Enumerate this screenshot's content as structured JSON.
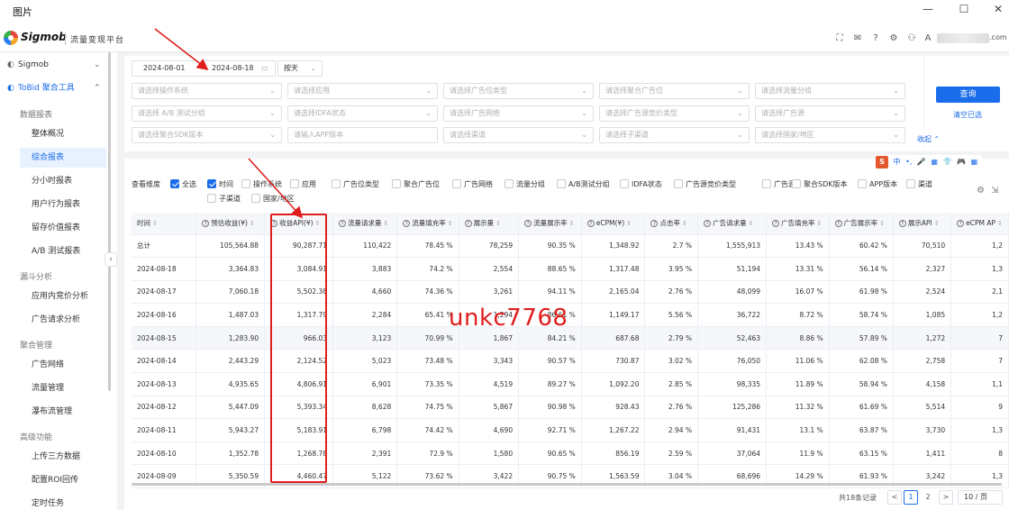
{
  "window": {
    "title": "图片"
  },
  "brand": {
    "name": "Sigmob",
    "subtitle": "流量变现平台",
    "email_suffix": ".com"
  },
  "sidebar": {
    "items": [
      {
        "label": "Sigmob"
      },
      {
        "label": "ToBid 聚合工具"
      }
    ],
    "groups": {
      "data_report": "数据报表",
      "funnel": "漏斗分析",
      "aggregation": "聚合管理",
      "advanced": "高级功能"
    },
    "data_report_items": [
      "整体概况",
      "综合报表",
      "分小时报表",
      "用户行为报表",
      "留存价值报表",
      "A/B 测试报表"
    ],
    "funnel_items": [
      "应用内竞价分析",
      "广告请求分析"
    ],
    "aggregation_items": [
      "广告网络",
      "流量管理",
      "瀑布流管理"
    ],
    "advanced_items": [
      "上传三方数据",
      "配置ROI回传",
      "定时任务"
    ]
  },
  "filters": {
    "date_start": "2024-08-01",
    "date_arrow": "→",
    "date_end": "2024-08-18",
    "granularity": "按天",
    "row1": [
      "请选择操作系统",
      "请选择应用",
      "请选择广告位类型",
      "请选择聚合广告位",
      "请选择流量分组"
    ],
    "row2": [
      "请选择 A/B 测试分组",
      "请选择IDFA状态",
      "请选择广告网络",
      "请选择广告源竞价类型",
      "请选择广告源"
    ],
    "row3": [
      "请选择聚合SDK版本",
      "请输入APP版本",
      "请选择渠道",
      "请选择子渠道",
      "请选择国家/地区"
    ],
    "query_label": "查询",
    "clear_label": "清空已选",
    "collapse_label": "收起 ⌃"
  },
  "dimensions": {
    "label": "查看维度",
    "select_all": "全选",
    "items": [
      "时间",
      "操作系统",
      "应用",
      "广告位类型",
      "聚合广告位",
      "广告网络",
      "流量分组",
      "A/B测试分组",
      "IDFA状态",
      "广告源竞价类型",
      "广告源",
      "聚合SDK版本",
      "APP版本",
      "渠道",
      "子渠道",
      "国家/地区"
    ],
    "checked": [
      "全选",
      "时间"
    ]
  },
  "ime": {
    "s": "S",
    "items": [
      "中",
      "•,",
      "🎤",
      "▦",
      "👕",
      "🎮",
      "▦"
    ]
  },
  "table": {
    "columns": [
      {
        "label": "时间",
        "q": false
      },
      {
        "label": "预估收益(¥)",
        "q": true
      },
      {
        "label": "收益API(¥)",
        "q": true
      },
      {
        "label": "流量请求量",
        "q": true
      },
      {
        "label": "流量填充率",
        "q": true
      },
      {
        "label": "展示量",
        "q": true
      },
      {
        "label": "流量展示率",
        "q": true
      },
      {
        "label": "eCPM(¥)",
        "q": true
      },
      {
        "label": "点击率",
        "q": true
      },
      {
        "label": "广告请求量",
        "q": true
      },
      {
        "label": "广告填充率",
        "q": true
      },
      {
        "label": "广告展示率",
        "q": true
      },
      {
        "label": "展示API",
        "q": true
      },
      {
        "label": "eCPM AP",
        "q": true
      }
    ],
    "rows": [
      [
        "总计",
        "105,564.88",
        "90,287.71",
        "110,422",
        "78.45 %",
        "78,259",
        "90.35 %",
        "1,348.92",
        "2.7 %",
        "1,555,913",
        "13.43 %",
        "60.42 %",
        "70,510",
        "1,2"
      ],
      [
        "2024-08-18",
        "3,364.83",
        "3,084.91",
        "3,883",
        "74.2 %",
        "2,554",
        "88.65 %",
        "1,317.48",
        "3.95 %",
        "51,194",
        "13.31 %",
        "56.14 %",
        "2,327",
        "1,3"
      ],
      [
        "2024-08-17",
        "7,060.18",
        "5,502.38",
        "4,660",
        "74.36 %",
        "3,261",
        "94.11 %",
        "2,165.04",
        "2.76 %",
        "48,099",
        "16.07 %",
        "61.98 %",
        "2,524",
        "2,1"
      ],
      [
        "2024-08-16",
        "1,487.03",
        "1,317.79",
        "2,284",
        "65.41 %",
        "1,294",
        "86.61 %",
        "1,149.17",
        "5.56 %",
        "36,722",
        "8.72 %",
        "58.74 %",
        "1,085",
        "1,2"
      ],
      [
        "2024-08-15",
        "1,283.90",
        "966.03",
        "3,123",
        "70.99 %",
        "1,867",
        "84.21 %",
        "687.68",
        "2.79 %",
        "52,463",
        "8.86 %",
        "57.89 %",
        "1,272",
        "7"
      ],
      [
        "2024-08-14",
        "2,443.29",
        "2,124.52",
        "5,023",
        "73.48 %",
        "3,343",
        "90.57 %",
        "730.87",
        "3.02 %",
        "76,050",
        "11.06 %",
        "62.08 %",
        "2,758",
        "7"
      ],
      [
        "2024-08-13",
        "4,935.65",
        "4,806.91",
        "6,901",
        "73.35 %",
        "4,519",
        "89.27 %",
        "1,092.20",
        "2.85 %",
        "98,335",
        "11.89 %",
        "58.94 %",
        "4,158",
        "1,1"
      ],
      [
        "2024-08-12",
        "5,447.09",
        "5,393.34",
        "8,628",
        "74.75 %",
        "5,867",
        "90.98 %",
        "928.43",
        "2.76 %",
        "125,286",
        "11.32 %",
        "61.69 %",
        "5,514",
        "9"
      ],
      [
        "2024-08-11",
        "5,943.27",
        "5,183.91",
        "6,798",
        "74.42 %",
        "4,690",
        "92.71 %",
        "1,267.22",
        "2.94 %",
        "91,431",
        "13.1 %",
        "63.87 %",
        "3,730",
        "1,3"
      ],
      [
        "2024-08-10",
        "1,352.78",
        "1,268.78",
        "2,391",
        "72.9 %",
        "1,580",
        "90.65 %",
        "856.19",
        "2.59 %",
        "37,064",
        "11.9 %",
        "63.15 %",
        "1,411",
        "8"
      ],
      [
        "2024-08-09",
        "5,350.59",
        "4,460.47",
        "5,122",
        "73.62 %",
        "3,422",
        "90.75 %",
        "1,563.59",
        "3.04 %",
        "68,696",
        "14.29 %",
        "61.93 %",
        "3,242",
        "1,3"
      ]
    ]
  },
  "annotation": {
    "watermark": "unkc7768",
    "color": "#e01e1e"
  },
  "pagination": {
    "total": "共18条记录",
    "pages": [
      "1",
      "2"
    ],
    "current": "1",
    "prev": "<",
    "next": ">",
    "page_size": "10 / 页"
  },
  "colors": {
    "primary": "#1a6dea",
    "annotation": "#e01e1e"
  }
}
